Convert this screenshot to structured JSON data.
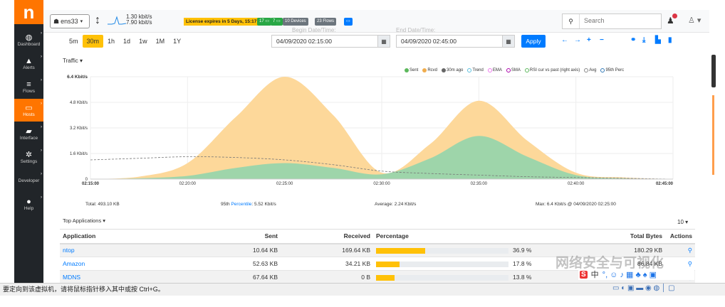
{
  "sidebar": {
    "logo": "n",
    "items": [
      {
        "icon": "dashboard-icon",
        "glyph": "◍",
        "label": "Dashboard",
        "active": false
      },
      {
        "icon": "alert-icon",
        "glyph": "▲",
        "label": "Alerts",
        "active": false
      },
      {
        "icon": "flows-icon",
        "glyph": "≡",
        "label": "Flows",
        "active": false
      },
      {
        "icon": "hosts-icon",
        "glyph": "▭",
        "label": "Hosts",
        "active": true
      },
      {
        "icon": "interface-icon",
        "glyph": "▰",
        "label": "Interface",
        "active": false
      },
      {
        "icon": "settings-icon",
        "glyph": "✲",
        "label": "Settings",
        "active": false
      },
      {
        "icon": "developer-icon",
        "glyph": "</>",
        "label": "Developer",
        "active": false
      },
      {
        "icon": "help-icon",
        "glyph": "●",
        "label": "Help",
        "active": false
      }
    ]
  },
  "topbar": {
    "interface": "ens33",
    "upload_rate": "1.30 kbit/s",
    "download_rate": "7.90 kbit/s",
    "license": "License expires in 5 Days, 15:17:48",
    "badges": [
      {
        "text": "17 ▭",
        "color": "#28a745"
      },
      {
        "text": "7 ▭",
        "color": "#28a745"
      },
      {
        "text": "10 Devices",
        "color": "#6c757d"
      },
      {
        "text": "23 Flows",
        "color": "#6c757d"
      },
      {
        "text": "▭",
        "color": "#007bff"
      }
    ],
    "search_placeholder": "Search"
  },
  "timerange": {
    "options": [
      "5m",
      "30m",
      "1h",
      "1d",
      "1w",
      "1M",
      "1Y"
    ],
    "selected": "30m",
    "begin": "04/09/2020 02:15:00",
    "end": "04/09/2020 02:45:00",
    "begin_label": "Begin Date/Time:",
    "end_label": "End Date/Time:",
    "apply": "Apply"
  },
  "chart_data": {
    "type": "area",
    "title": "Traffic",
    "x": [
      "02:15:00",
      "02:17:30",
      "02:20:00",
      "02:22:30",
      "02:25:00",
      "02:27:30",
      "02:30:00",
      "02:32:30",
      "02:35:00",
      "02:37:30",
      "02:40:00",
      "02:42:30",
      "02:45:00"
    ],
    "x_ticks": [
      "02:15:00",
      "02:20:00",
      "02:25:00",
      "02:30:00",
      "02:35:00",
      "02:40:00",
      "02:45:00"
    ],
    "y_ticks": [
      "6.4 Kbit/s",
      "4.8 Kbit/s",
      "3.2 Kbit/s",
      "1.6 Kbit/s",
      "0"
    ],
    "ylim": [
      0,
      6.4
    ],
    "series": [
      {
        "name": "Rcvd",
        "color": "#fdd89a",
        "values": [
          0,
          0.15,
          1.0,
          3.9,
          6.4,
          4.0,
          0.4,
          2.2,
          4.9,
          2.4,
          0.4,
          0.1,
          0
        ]
      },
      {
        "name": "Sent",
        "color": "#9ed5aa",
        "values": [
          0,
          0.05,
          0.2,
          0.7,
          1.0,
          0.7,
          0.3,
          1.3,
          2.7,
          1.4,
          0.25,
          0.05,
          0
        ]
      },
      {
        "name": "30m ago",
        "color": "#777777",
        "values": [
          1.2,
          1.3,
          1.4,
          1.35,
          1.2,
          0.9,
          0.5,
          0.35,
          0.25,
          0.15,
          0.1,
          0.05,
          0
        ]
      }
    ],
    "legend": [
      "Sent",
      "Rcvd",
      "30m ago",
      "Trend",
      "EMA",
      "SMA",
      "RSI cur vs past (right axis)",
      "Avg",
      "95th Perc"
    ],
    "legend_colors": [
      "#5cb85c",
      "#f0ad4e",
      "#666666",
      "#5bc0de",
      "#ee77ee",
      "#aa00aa",
      "#5cb85c",
      "#888888",
      "#337ab7"
    ],
    "legend_position": "top-right"
  },
  "stats": {
    "total": "Total: 493.10 KB",
    "perc_prefix": "95th",
    "perc_link": "Percentile",
    "perc_value": ": 5.52 Kbit/s",
    "average": "Average: 2.24 Kbit/s",
    "max": "Max: 6.4 Kbit/s @ 04/09/2020 02:25:00"
  },
  "top_apps": {
    "label": "Top Applications",
    "page_size": "10",
    "columns": [
      "Application",
      "Sent",
      "Received",
      "Percentage",
      "Total Bytes",
      "Actions"
    ],
    "rows": [
      {
        "app": "ntop",
        "sent": "10.64 KB",
        "received": "169.64 KB",
        "percentage": 36.9,
        "pct_label": "36.9 %",
        "total": "180.29 KB"
      },
      {
        "app": "Amazon",
        "sent": "52.63 KB",
        "received": "34.21 KB",
        "percentage": 17.8,
        "pct_label": "17.8 %",
        "total": "86.84 KB"
      },
      {
        "app": "MDNS",
        "sent": "67.64 KB",
        "received": "0 B",
        "percentage": 13.8,
        "pct_label": "13.8 %",
        "total": "67.64 KB"
      }
    ]
  },
  "overlay": {
    "watermark": "网络安全与可视化",
    "ime_logo": "S",
    "ime_mode": "中",
    "ime_icons": "°, ☺ ♪ ▦ ♣ ♠ ▣"
  },
  "status_bar": {
    "message": "要定向到该虚拟机，请将鼠标指针移入其中或按 Ctrl+G。",
    "tray": "▭ ◐ ▣ ▬ ◉ ◍ │ ▢"
  }
}
